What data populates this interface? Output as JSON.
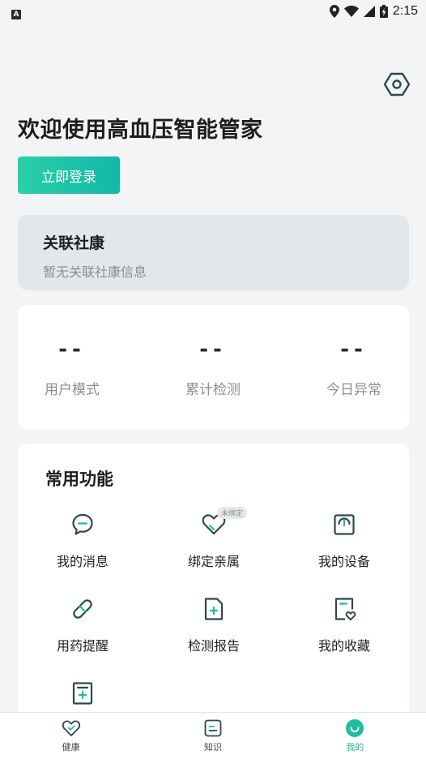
{
  "status_bar": {
    "time": "2:15",
    "left_icon": "A"
  },
  "header": {
    "welcome_title": "欢迎使用高血压智能管家",
    "login_button": "立即登录",
    "settings_icon": "settings-hexagon-icon"
  },
  "community": {
    "title": "关联社康",
    "subtitle": "暂无关联社康信息"
  },
  "stats": [
    {
      "value": "--",
      "label": "用户模式"
    },
    {
      "value": "--",
      "label": "累计检测"
    },
    {
      "value": "--",
      "label": "今日异常"
    }
  ],
  "functions": {
    "title": "常用功能",
    "items": [
      {
        "label": "我的消息",
        "icon": "message-icon"
      },
      {
        "label": "绑定亲属",
        "icon": "heart-link-icon",
        "badge": "未绑定"
      },
      {
        "label": "我的设备",
        "icon": "device-icon"
      },
      {
        "label": "用药提醒",
        "icon": "pill-icon"
      },
      {
        "label": "检测报告",
        "icon": "report-icon"
      },
      {
        "label": "我的收藏",
        "icon": "favorite-doc-icon"
      },
      {
        "label": "",
        "icon": "medical-record-icon"
      }
    ]
  },
  "bottom_nav": [
    {
      "label": "健康",
      "icon": "heart-icon"
    },
    {
      "label": "知识",
      "icon": "knowledge-icon"
    },
    {
      "label": "我的",
      "icon": "profile-icon",
      "active": true
    }
  ],
  "colors": {
    "accent": "#1bbf9f",
    "icon": "#2c4a4a",
    "background": "#f3f4f5"
  }
}
